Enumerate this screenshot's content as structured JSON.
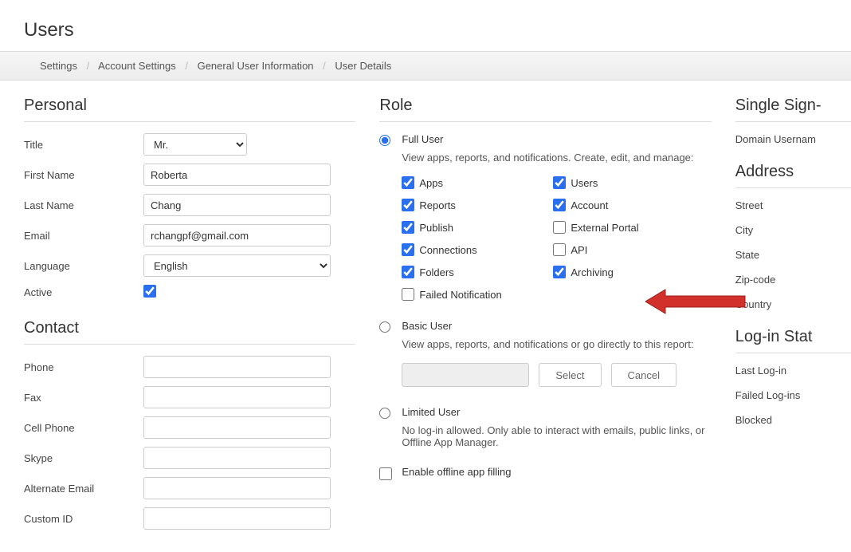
{
  "page": {
    "title": "Users"
  },
  "breadcrumb": {
    "b1": "Settings",
    "b2": "Account Settings",
    "b3": "General User Information",
    "b4": "User Details"
  },
  "personal": {
    "heading": "Personal",
    "title_label": "Title",
    "title_value": "Mr.",
    "first_name_label": "First Name",
    "first_name_value": "Roberta",
    "last_name_label": "Last Name",
    "last_name_value": "Chang",
    "email_label": "Email",
    "email_value": "rchangpf@gmail.com",
    "language_label": "Language",
    "language_value": "English",
    "active_label": "Active"
  },
  "contact": {
    "heading": "Contact",
    "phone_label": "Phone",
    "fax_label": "Fax",
    "cell_label": "Cell Phone",
    "skype_label": "Skype",
    "alt_email_label": "Alternate Email",
    "custom_id_label": "Custom ID"
  },
  "role": {
    "heading": "Role",
    "full": {
      "name": "Full User",
      "desc": "View apps, reports, and notifications. Create, edit, and manage:",
      "perm_apps": "Apps",
      "perm_reports": "Reports",
      "perm_publish": "Publish",
      "perm_connections": "Connections",
      "perm_folders": "Folders",
      "perm_failed": "Failed Notification",
      "perm_users": "Users",
      "perm_account": "Account",
      "perm_external": "External Portal",
      "perm_api": "API",
      "perm_archiving": "Archiving"
    },
    "basic": {
      "name": "Basic User",
      "desc": "View apps, reports, and notifications or go directly to this report:",
      "select_btn": "Select",
      "cancel_btn": "Cancel"
    },
    "limited": {
      "name": "Limited User",
      "desc": "No log-in allowed. Only able to interact with emails, public links, or Offline App Manager."
    },
    "offline_label": "Enable offline app filling"
  },
  "sso": {
    "heading": "Single Sign-",
    "domain_user_label": "Domain Usernam"
  },
  "address": {
    "heading": "Address",
    "street": "Street",
    "city": "City",
    "state": "State",
    "zip": "Zip-code",
    "country": "Country"
  },
  "login": {
    "heading": "Log-in Stat",
    "last": "Last Log-in",
    "failed": "Failed Log-ins",
    "blocked": "Blocked"
  }
}
